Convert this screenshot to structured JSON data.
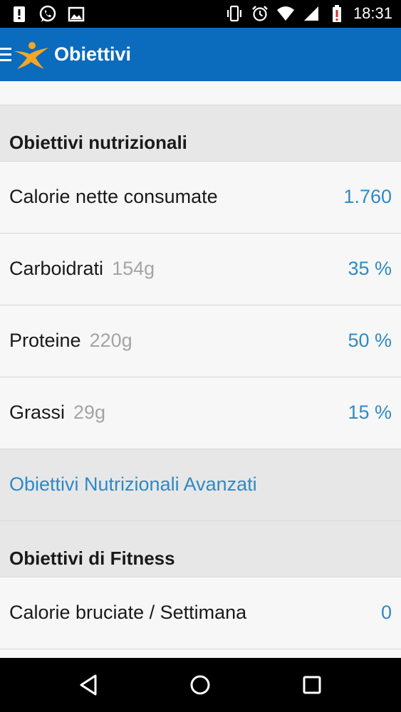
{
  "status_bar": {
    "time": "18:31",
    "icons": [
      "alert-icon",
      "whatsapp-icon",
      "image-icon",
      "vibrate-icon",
      "alarm-icon",
      "wifi-icon",
      "signal-icon",
      "battery-low-icon"
    ]
  },
  "app_bar": {
    "title": "Obiettivi"
  },
  "nutrition": {
    "header": "Obiettivi nutrizionali",
    "rows": [
      {
        "label": "Calorie nette consumate",
        "sub": "",
        "value": "1.760"
      },
      {
        "label": "Carboidrati",
        "sub": "154g",
        "value": "35 %"
      },
      {
        "label": "Proteine",
        "sub": "220g",
        "value": "50 %"
      },
      {
        "label": "Grassi",
        "sub": "29g",
        "value": "15 %"
      }
    ],
    "advanced_link": "Obiettivi Nutrizionali Avanzati"
  },
  "fitness": {
    "header": "Obiettivi di Fitness",
    "rows": [
      {
        "label": "Calorie bruciate / Settimana",
        "value": "0"
      }
    ]
  },
  "colors": {
    "app_bar": "#0b6bbd",
    "accent": "#2f8ac6",
    "logo": "#f5a623"
  }
}
